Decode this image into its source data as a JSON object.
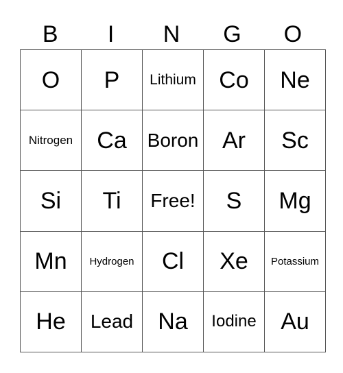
{
  "header": [
    "B",
    "I",
    "N",
    "G",
    "O"
  ],
  "rows": [
    [
      "O",
      "P",
      "Lithium",
      "Co",
      "Ne"
    ],
    [
      "Nitrogen",
      "Ca",
      "Boron",
      "Ar",
      "Sc"
    ],
    [
      "Si",
      "Ti",
      "Free!",
      "S",
      "Mg"
    ],
    [
      "Mn",
      "Hydrogen",
      "Cl",
      "Xe",
      "Potassium"
    ],
    [
      "He",
      "Lead",
      "Na",
      "Iodine",
      "Au"
    ]
  ]
}
